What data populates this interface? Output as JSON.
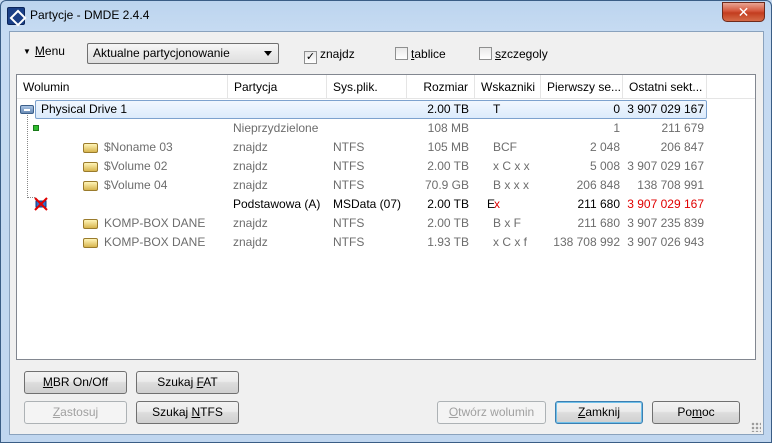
{
  "window": {
    "title": "Partycje - DMDE 2.4.4",
    "close_glyph": "✕"
  },
  "toolbar": {
    "menu_arrow": "▼",
    "menu_prefix": "",
    "menu_underlined": "M",
    "menu_rest": "enu",
    "combo_value": "Aktualne partycjonowanie",
    "checks": [
      {
        "label_u": "",
        "label_rest": "znajdz",
        "checked": true,
        "mark": "✓"
      },
      {
        "label_u": "t",
        "label_rest": "ablice",
        "checked": false,
        "mark": ""
      },
      {
        "label_u": "s",
        "label_rest": "zczegoly",
        "checked": false,
        "mark": ""
      }
    ]
  },
  "table": {
    "headers": [
      "Wolumin",
      "Partycja",
      "Sys.plik.",
      "Rozmiar",
      "Wskazniki",
      "Pierwszy se...",
      "Ostatni sekt..."
    ],
    "rows": [
      {
        "name": "Physical Drive 1",
        "part": "",
        "fs": "",
        "size": "2.00 TB",
        "flags_a": "T",
        "flags_b": "",
        "first": "0",
        "last": "3 907 029 167",
        "style": "drive"
      },
      {
        "name": "",
        "part": "Nieprzydzielone",
        "fs": "",
        "size": "108 MB",
        "flags_a": "",
        "flags_b": "",
        "first": "1",
        "last": "211 679",
        "style": "unalloc"
      },
      {
        "name": "$Noname 03",
        "part": "znajdz",
        "fs": "NTFS",
        "size": "105 MB",
        "flags_a": "BCF",
        "flags_b": "",
        "first": "2 048",
        "last": "206 847",
        "style": "found"
      },
      {
        "name": "$Volume 02",
        "part": "znajdz",
        "fs": "NTFS",
        "size": "2.00 TB",
        "flags_a": "x C x x",
        "flags_b": "",
        "first": "5 008",
        "last": "3 907 029 167",
        "style": "found"
      },
      {
        "name": "$Volume 04",
        "part": "znajdz",
        "fs": "NTFS",
        "size": "70.9 GB",
        "flags_a": "B x x x",
        "flags_b": "",
        "first": "206 848",
        "last": "138 708 991",
        "style": "found"
      },
      {
        "name": "",
        "part": "Podstawowa (A)",
        "fs": "MSData (07)",
        "size": "2.00 TB",
        "flags_a": "E",
        "flags_b": "x",
        "first": "211 680",
        "last": "3 907 029 167",
        "style": "primary"
      },
      {
        "name": "KOMP-BOX DANE",
        "part": "znajdz",
        "fs": "NTFS",
        "size": "2.00 TB",
        "flags_a": "B x F",
        "flags_b": "",
        "first": "211 680",
        "last": "3 907 235 839",
        "style": "found"
      },
      {
        "name": "KOMP-BOX DANE",
        "part": "znajdz",
        "fs": "NTFS",
        "size": "1.93 TB",
        "flags_a": "x C x f",
        "flags_b": "",
        "first": "138 708 992",
        "last": "3 907 026 943",
        "style": "found"
      }
    ]
  },
  "buttons": {
    "mbr": {
      "u": "M",
      "rest": "BR On/Off"
    },
    "fat": {
      "pre": "Szukaj ",
      "u": "F",
      "rest": "AT"
    },
    "apply": {
      "pre": "",
      "u": "Z",
      "rest": "astosuj"
    },
    "ntfs": {
      "pre": "Szukaj ",
      "u": "N",
      "rest": "TFS"
    },
    "open": {
      "pre": "",
      "u": "O",
      "rest": "twórz wolumin"
    },
    "close": {
      "pre": "",
      "u": "Z",
      "rest": "amknij"
    },
    "help": {
      "pre": "Po",
      "u": "m",
      "rest": "oc"
    }
  },
  "colors": {
    "accent_red": "#e00000",
    "gray_text": "#6d6d6d",
    "selection": "#dcebfc"
  }
}
